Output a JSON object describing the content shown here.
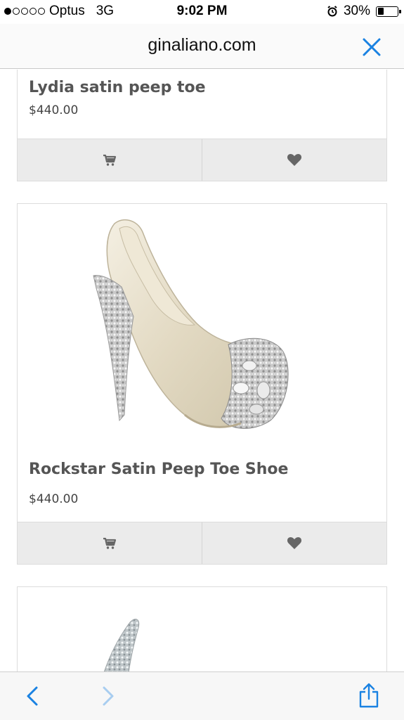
{
  "status_bar": {
    "carrier": "Optus",
    "network": "3G",
    "time": "9:02 PM",
    "battery_percent": "30%",
    "battery_level": 0.3,
    "signal_bars_filled": 1,
    "signal_bars_total": 5
  },
  "browser": {
    "url": "ginaliano.com",
    "close_icon": "close-icon",
    "accent_color": "#1a82e2"
  },
  "products": [
    {
      "title": "Lydia satin peep toe",
      "price": "$440.00",
      "cart_icon": "cart-icon",
      "wishlist_icon": "heart-icon"
    },
    {
      "title": "Rockstar Satin Peep Toe Shoe",
      "price": "$440.00",
      "image": "shoe-image",
      "cart_icon": "cart-icon",
      "wishlist_icon": "heart-icon"
    },
    {
      "image": "shoe-image"
    }
  ],
  "toolbar": {
    "back_icon": "back-chevron-icon",
    "forward_icon": "forward-chevron-icon",
    "share_icon": "share-icon"
  }
}
